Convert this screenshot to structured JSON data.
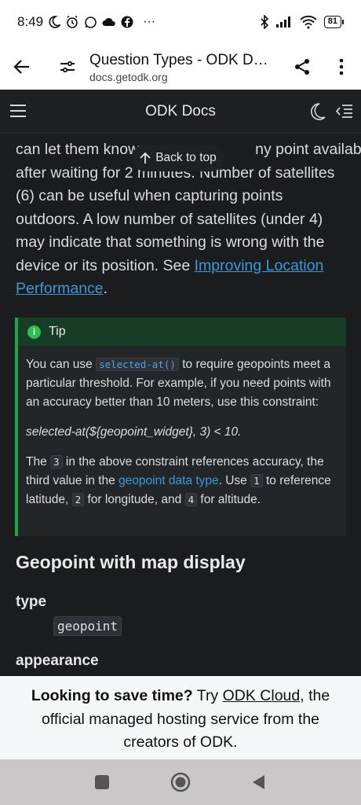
{
  "status": {
    "time": "8:49",
    "battery": "81",
    "more": "···"
  },
  "browser": {
    "page_title": "Question Types - ODK Docs",
    "url": "docs.getodk.org"
  },
  "docs_header": {
    "title": "ODK Docs"
  },
  "content": {
    "back_to_top": "Back to top",
    "para_partial_1": "can let them know",
    "para_partial_2": "ny point available",
    "para_line_2a": "after waiting for 2",
    "para_line_2b": "minutes. Number of satellites",
    "para_rest": "(6) can be useful when capturing points outdoors. A low number of satellites (under 4) may indicate that something is wrong with the device or its position. See",
    "para_link": "Improving Location Performance",
    "para_end": ".",
    "tip": {
      "label": "Tip",
      "p1_a": "You can use",
      "p1_code": "selected-at()",
      "p1_b": "to require geopoints meet a particular threshold. For example, if you need points with an accuracy better than 10 meters, use this constraint:",
      "p2": "selected-at(${geopoint_widget}, 3) < 10.",
      "p3_a": "The",
      "p3_code1": "3",
      "p3_b": "in the above constraint references accuracy, the third value in the",
      "p3_link": "geopoint data type",
      "p3_c": ". Use",
      "p3_code2": "1",
      "p3_d": "to reference latitude,",
      "p3_code3": "2",
      "p3_e": "for longitude, and",
      "p3_code4": "4",
      "p3_f": "for altitude."
    },
    "heading": "Geopoint with map display",
    "dt_type": "type",
    "dd_type": "geopoint",
    "dt_appearance": "appearance"
  },
  "banner": {
    "bold": "Looking to save time?",
    "try": " Try ",
    "link": "ODK Cloud",
    "rest": ", the official managed hosting service from the creators of ODK."
  },
  "colors": {
    "tip_accent": "#1fa64a",
    "link": "#3a9ad9",
    "page_bg": "#1b1c1e"
  }
}
